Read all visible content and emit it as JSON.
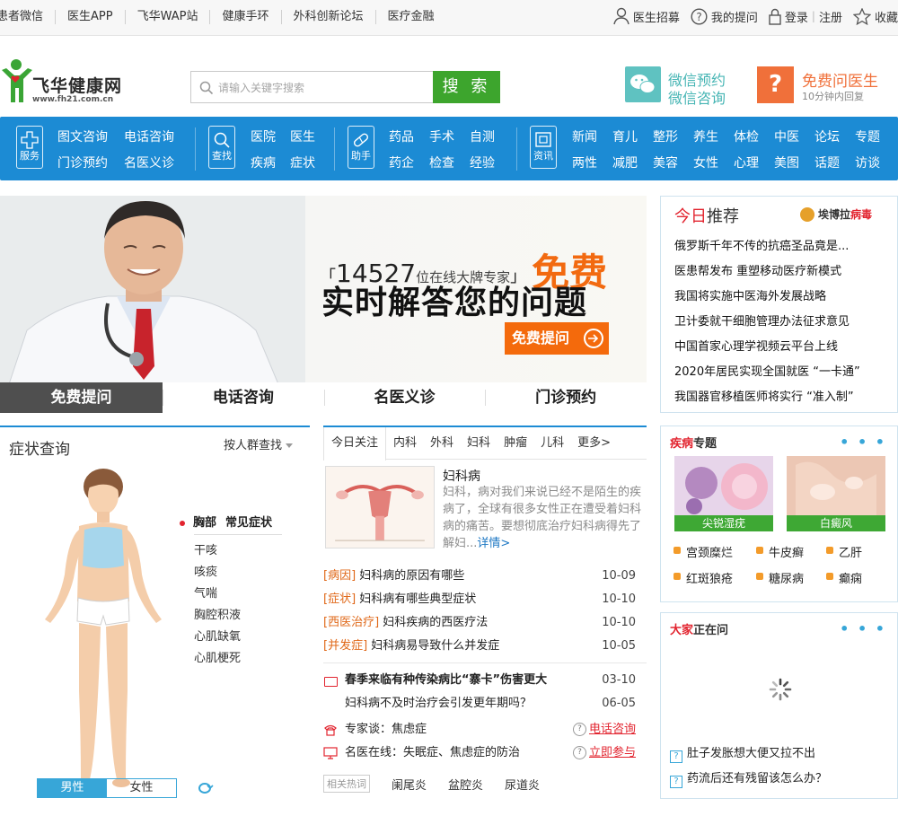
{
  "topbar": {
    "links": [
      "患者微信",
      "医生APP",
      "飞华WAP站",
      "健康手环",
      "外科创新论坛",
      "医疗金融"
    ],
    "recruit": "医生招募",
    "my_question": "我的提问",
    "login": "登录",
    "sep": "|",
    "register": "注册",
    "favorite": "收藏"
  },
  "header": {
    "logo_name": "飞华健康网",
    "logo_url": "www.fh21.com.cn",
    "search_placeholder": "请输入关键字搜索",
    "search_button": "搜 索",
    "wechat_line1": "微信预约",
    "wechat_line2": "微信咨询",
    "ask_line1": "免费问医生",
    "ask_line2": "10分钟内回复"
  },
  "nav": {
    "groups": [
      {
        "icon": "plus-icon",
        "label": "服务",
        "items": [
          "图文咨询",
          "电话咨询",
          "门诊预约",
          "名医义诊"
        ]
      },
      {
        "icon": "search-icon",
        "label": "查找",
        "items": [
          "医院",
          "医生",
          "疾病",
          "症状"
        ]
      },
      {
        "icon": "pill-icon",
        "label": "助手",
        "items": [
          "药品",
          "手术",
          "自测",
          "药企",
          "检查",
          "经验"
        ]
      },
      {
        "icon": "screen-icon",
        "label": "资讯",
        "items": [
          "新闻",
          "育儿",
          "整形",
          "养生",
          "体检",
          "中医",
          "论坛",
          "专题",
          "两性",
          "减肥",
          "美容",
          "女性",
          "心理",
          "美图",
          "话题",
          "访谈"
        ]
      }
    ]
  },
  "banner": {
    "count": "14527",
    "count_suffix": "位在线大牌专家",
    "free": "免费",
    "headline": "实时解答您的问题",
    "button": "免费提问",
    "tabs": [
      "免费提问",
      "电话咨询",
      "名医义诊",
      "门诊预约"
    ]
  },
  "recommend": {
    "title_red": "今日",
    "title_rest": "推荐",
    "ad_name": "埃博拉",
    "ad_red": "病毒",
    "items": [
      "俄罗斯千年不传的抗癌圣品竟是...",
      "医患帮发布 重塑移动医疗新模式",
      "我国将实施中医海外发展战略",
      "卫计委就干细胞管理办法征求意见",
      "中国首家心理学视频云平台上线",
      "2020年居民实现全国就医 “一卡通”",
      "我国器官移植医师将实行 “准入制”"
    ]
  },
  "symptom": {
    "title": "症状查询",
    "filter": "按人群查找",
    "part": "胸部",
    "part_sub": "常见症状",
    "list": [
      "干咳",
      "咳痰",
      "气喘",
      "胸腔积液",
      "心肌缺氧",
      "心肌梗死"
    ],
    "gender": [
      "男性",
      "女性"
    ]
  },
  "center": {
    "tabs": [
      "今日关注",
      "内科",
      "外科",
      "妇科",
      "肿瘤",
      "儿科",
      "更多>"
    ],
    "feature_title": "妇科病",
    "feature_desc": "妇科，病对我们来说已经不是陌生的疾病了，全球有很多女性正在遭受着妇科病的痛苦。要想彻底治疗妇科病得先了解妇...",
    "feature_more": "详情>",
    "list1": [
      {
        "tag": "[病因]",
        "title": "妇科病的原因有哪些",
        "date": "10-09"
      },
      {
        "tag": "[症状]",
        "title": "妇科病有哪些典型症状",
        "date": "10-10"
      },
      {
        "tag": "[西医治疗]",
        "title": "妇科疾病的西医疗法",
        "date": "10-10"
      },
      {
        "tag": "[并发症]",
        "title": "妇科病易导致什么并发症",
        "date": "10-05"
      }
    ],
    "list2": [
      {
        "title": "春季来临有种传染病比“寨卡”伤害更大",
        "date": "03-10",
        "bold": true
      },
      {
        "title": "妇科病不及时治疗会引发更年期吗？",
        "date": "06-05",
        "bold": false
      }
    ],
    "expert_l": "专家谈：焦虑症",
    "expert_r": "电话咨询",
    "online_l": "名医在线：失眠症、焦虑症的防治",
    "online_r": "立即参与",
    "hot_label": "相关热词",
    "hot_words": [
      "阑尾炎",
      "盆腔炎",
      "尿道炎"
    ]
  },
  "topic": {
    "title_red": "疾病",
    "title_rest": "专题",
    "images": [
      "尖锐湿疣",
      "白癜风"
    ],
    "tags": [
      "宫颈糜烂",
      "牛皮癣",
      "乙肝",
      "红斑狼疮",
      "糖尿病",
      "癫痫"
    ]
  },
  "asking": {
    "title_red": "大家",
    "title_rest": "正在问",
    "items": [
      "肚子发胀想大便又拉不出",
      "药流后还有残留该怎么办？"
    ]
  },
  "colors": {
    "nav_blue": "#1c8bd4",
    "search_green": "#3da52d",
    "accent_orange": "#f46a0c",
    "red": "#e2242f"
  }
}
